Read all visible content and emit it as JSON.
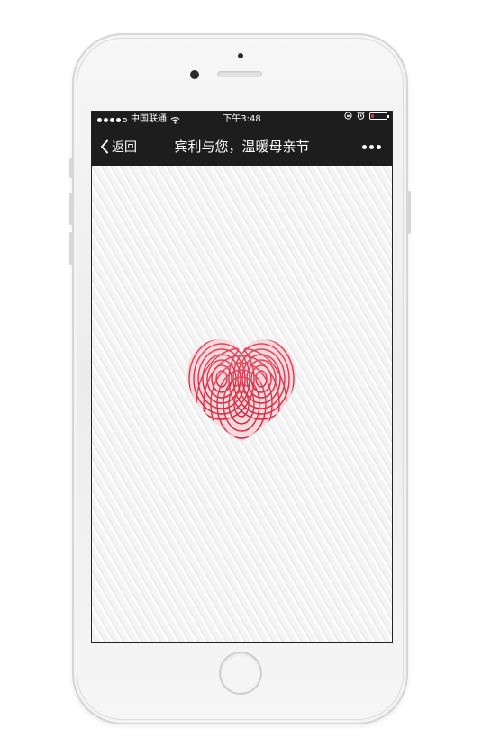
{
  "statusbar": {
    "carrier": "中国联通",
    "time": "下午3:48",
    "battery_level": 0.2,
    "icons": [
      "signal-dots-icon",
      "wifi-icon",
      "lock-rotation-icon",
      "alarm-icon",
      "battery-icon"
    ]
  },
  "navbar": {
    "back_label": "返回",
    "title": "宾利与您，温暖母亲节",
    "icons": [
      "chevron-left-icon",
      "more-icon"
    ]
  },
  "content": {
    "image": "fingerprint-heart",
    "colors": {
      "heart": "#c8102e",
      "background": "#f4f4f4"
    }
  },
  "colors": {
    "bar": "#1d1d1d",
    "phone_body": "#efefef"
  }
}
